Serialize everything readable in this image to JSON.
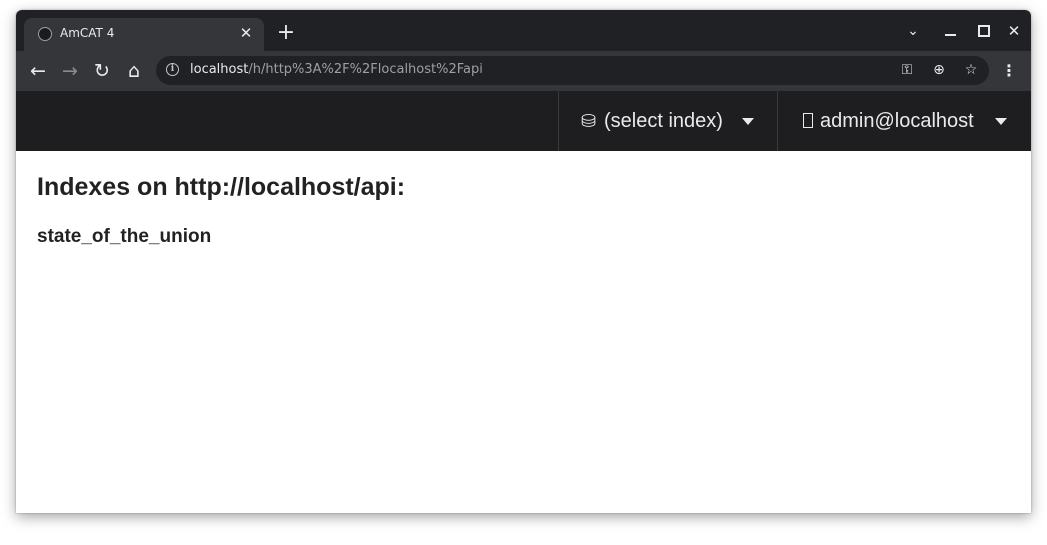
{
  "browser": {
    "tab": {
      "title": "AmCAT 4",
      "close_glyph": "✕"
    },
    "new_tab_glyph": "+",
    "window_controls": {
      "dropdown_glyph": "⌄",
      "close_glyph": "✕"
    },
    "nav": {
      "back_glyph": "←",
      "forward_glyph": "→",
      "reload_glyph": "↻",
      "home_glyph": "⌂"
    },
    "address": {
      "host": "localhost",
      "path": "/h/http%3A%2F%2Flocalhost%2Fapi"
    },
    "icons": {
      "key_glyph": "⚿",
      "zoom_glyph": "⊕",
      "star_glyph": "☆",
      "menu_glyph": "⋮",
      "info_glyph": "i"
    }
  },
  "header": {
    "index_selector": {
      "icon": "database-icon",
      "icon_glyph": "⛁",
      "label": "(select index)"
    },
    "user_menu": {
      "icon": "user-icon",
      "label": "admin@localhost"
    }
  },
  "main": {
    "title": "Indexes on http://localhost/api:",
    "indexes": [
      "state_of_the_union"
    ]
  },
  "colors": {
    "tabstrip_bg": "#202124",
    "toolbar_bg": "#35363a",
    "header_bg": "#1e1e20",
    "text_dark": "#222222"
  }
}
